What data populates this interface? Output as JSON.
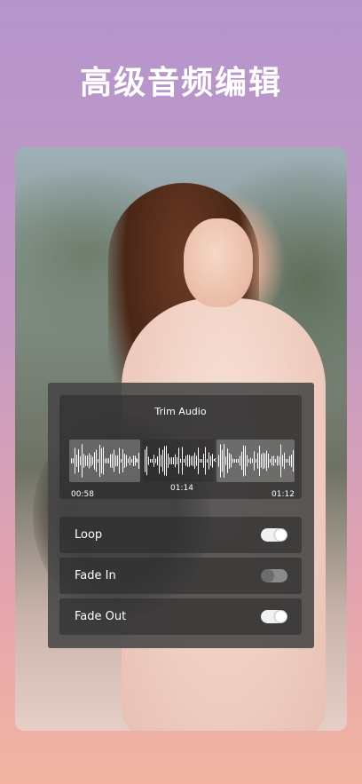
{
  "headline": "高级音频编辑",
  "trim": {
    "title": "Trim Audio",
    "start_time": "00:58",
    "mid_time": "01:14",
    "end_time": "01:12"
  },
  "options": [
    {
      "label": "Loop",
      "on": true
    },
    {
      "label": "Fade In",
      "on": false
    },
    {
      "label": "Fade Out",
      "on": true
    }
  ],
  "colors": {
    "toggle_on": "#f1f1f1",
    "toggle_off": "#8a8a8a",
    "panel": "#464646"
  }
}
